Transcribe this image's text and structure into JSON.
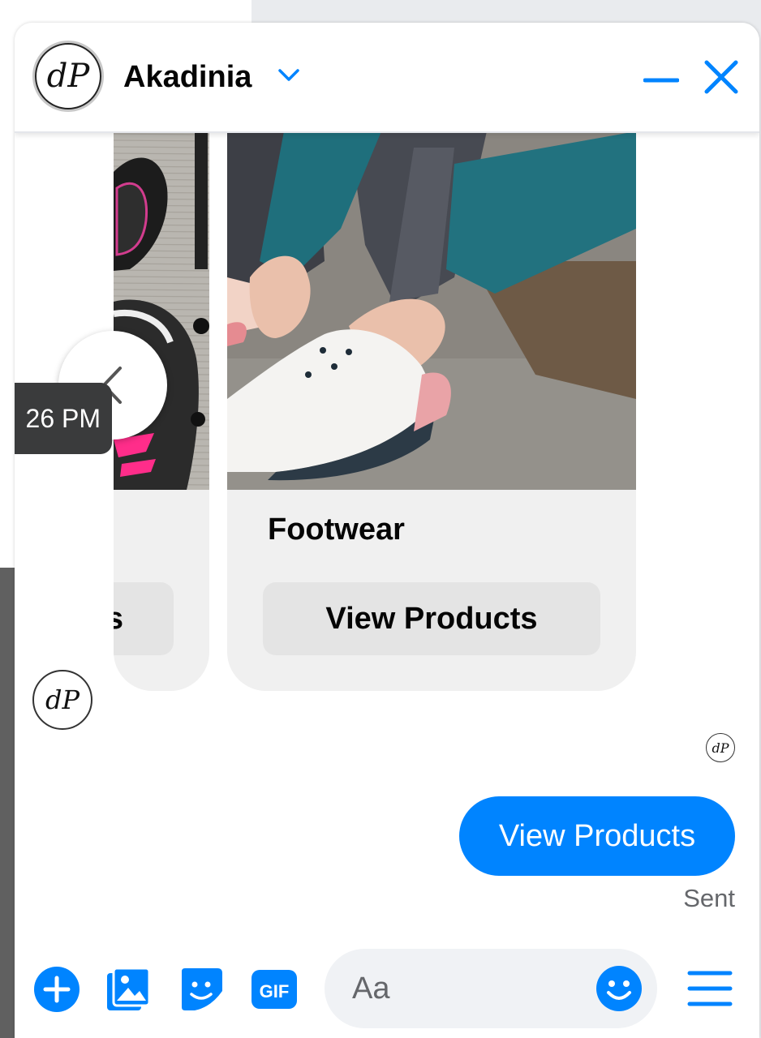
{
  "header": {
    "page_name": "Akadinia",
    "avatar_monogram": "dP"
  },
  "carousel": {
    "tooltip_time": "26 PM",
    "left_card": {
      "button_fragment": "s"
    },
    "right_card": {
      "title": "Footwear",
      "button_label": "View Products"
    }
  },
  "conversation": {
    "sent_message": "View Products",
    "status": "Sent"
  },
  "composer": {
    "placeholder": "Aa",
    "gif_label": "GIF"
  },
  "colors": {
    "accent": "#0084ff",
    "card_bg": "#f0f0f0",
    "button_bg": "#e4e4e4",
    "tooltip_bg": "#3a3b3c"
  }
}
